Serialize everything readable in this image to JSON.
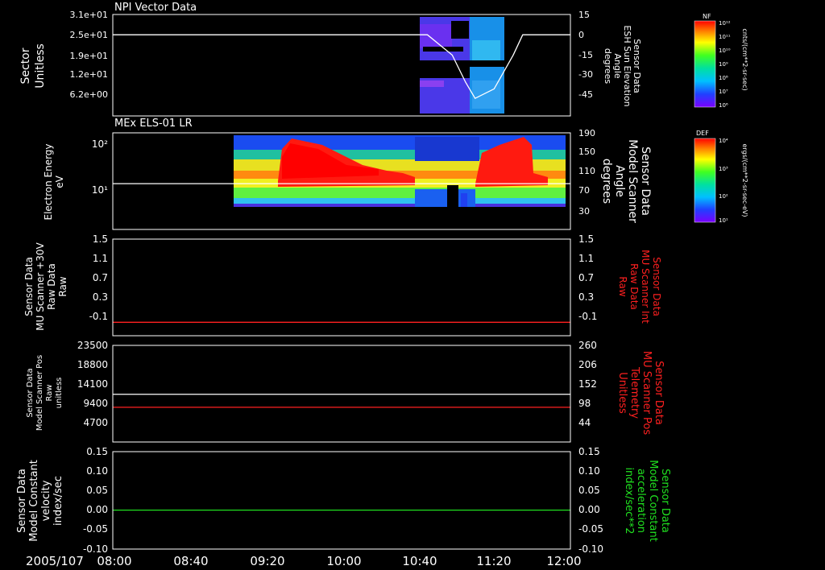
{
  "date_label": "2005/107",
  "time_ticks": [
    "08:00",
    "08:40",
    "09:20",
    "10:00",
    "10:40",
    "11:20",
    "12:00"
  ],
  "colors": {
    "white": "#ffffff",
    "red": "#ff2020",
    "green": "#20e020",
    "background": "#000000"
  },
  "panels": [
    {
      "id": "panel1",
      "title": "NPI Vector Data",
      "left_label": [
        "Sector",
        "Unitless"
      ],
      "left_ticks": [
        "3.1e+01",
        "2.5e+01",
        "1.9e+01",
        "1.2e+01",
        "6.2e+00"
      ],
      "right_label": [
        "Sensor Data",
        "ESH Sun Elevation",
        "Angle",
        "degrees"
      ],
      "right_ticks": [
        "15",
        "0",
        "-15",
        "-30",
        "-45"
      ]
    },
    {
      "id": "panel2",
      "title": "MEx ELS-01 LR",
      "left_label": [
        "Electron Energy",
        "eV"
      ],
      "left_ticks": [
        "10²",
        "10¹"
      ],
      "right_label": [
        "Sensor Data",
        "Model Scanner",
        "Angle",
        "degrees"
      ],
      "right_ticks": [
        "190",
        "150",
        "110",
        "70",
        "30"
      ]
    },
    {
      "id": "panel3",
      "left_label": [
        "Sensor Data",
        "MU Scanner +30V",
        "Raw Data",
        "Raw"
      ],
      "left_ticks": [
        "1.5",
        "1.1",
        "0.7",
        "0.3",
        "-0.1"
      ],
      "right_label": [
        "Sensor Data",
        "MU Scanner Int",
        "Raw Data",
        "Raw"
      ],
      "right_ticks": [
        "1.5",
        "1.1",
        "0.7",
        "0.3",
        "-0.1"
      ]
    },
    {
      "id": "panel4",
      "left_label": [
        "Sensor Data",
        "Model Scanner Pos",
        "Raw",
        "unitless"
      ],
      "left_ticks": [
        "23500",
        "18800",
        "14100",
        "9400",
        "4700"
      ],
      "right_label": [
        "Sensor Data",
        "MU Scanner Pos",
        "Telemetry",
        "Unitless"
      ],
      "right_ticks": [
        "260",
        "206",
        "152",
        "98",
        "44"
      ]
    },
    {
      "id": "panel5",
      "left_label": [
        "Sensor Data",
        "Model Constant",
        "velocity",
        "index/sec"
      ],
      "left_ticks": [
        "0.15",
        "0.10",
        "0.05",
        "0.00",
        "-0.05",
        "-0.10"
      ],
      "right_label": [
        "Sensor Data",
        "Model Constant",
        "acceleration",
        "index/sec**2"
      ],
      "right_ticks": [
        "0.15",
        "0.10",
        "0.05",
        "0.00",
        "-0.05",
        "-0.10"
      ]
    }
  ],
  "colorbars": [
    {
      "id": "colorbar-nf",
      "title": "NF",
      "units": "cnts/(cm**2-sr-sec)",
      "ticks": [
        "10¹²",
        "10¹¹",
        "10¹⁰",
        "10⁹",
        "10⁸",
        "10⁷",
        "10⁶"
      ]
    },
    {
      "id": "colorbar-def",
      "title": "DEF",
      "units": "ergs/(cm**2-sr-sec-eV)",
      "ticks": [
        "10⁴",
        "10³",
        "10²",
        "10¹"
      ]
    }
  ],
  "chart_data": [
    {
      "type": "heatmap",
      "title": "NPI Vector Data",
      "ylabel": "Sector Unitless",
      "x_range": [
        "08:00",
        "12:00"
      ],
      "y_range": [
        0,
        31
      ],
      "data_extent": [
        "10:40",
        "11:25"
      ],
      "overlay_line": {
        "name": "ESH Sun Elevation Angle",
        "axis": "right",
        "ylim": [
          -60,
          15
        ],
        "x": [
          "08:00",
          "10:45",
          "10:58",
          "11:05",
          "11:10",
          "11:20",
          "11:30",
          "11:35",
          "12:00"
        ],
        "y": [
          0,
          0,
          -15,
          -35,
          -47,
          -40,
          -15,
          0,
          0
        ]
      }
    },
    {
      "type": "heatmap",
      "title": "MEx ELS-01 LR",
      "ylabel": "Electron Energy eV",
      "yscale": "log",
      "x_range": [
        "08:00",
        "12:00"
      ],
      "data_extent": [
        "09:00",
        "12:00"
      ],
      "overlay_line": {
        "name": "Model Scanner Angle",
        "axis": "right",
        "ylim": [
          0,
          190
        ],
        "x": [
          "08:00",
          "12:00"
        ],
        "y": [
          90,
          90
        ]
      }
    },
    {
      "type": "line",
      "x_range": [
        "08:00",
        "12:00"
      ],
      "ylim": [
        -0.3,
        1.5
      ],
      "series": [
        {
          "name": "MU Scanner Int Raw Data",
          "color": "#ff2020",
          "x": [
            "08:00",
            "12:00"
          ],
          "y": [
            -0.05,
            -0.05
          ]
        }
      ]
    },
    {
      "type": "line",
      "x_range": [
        "08:00",
        "12:00"
      ],
      "ylim": [
        0,
        23500
      ],
      "y2lim": [
        -10,
        260
      ],
      "series": [
        {
          "name": "Model Scanner Pos Raw",
          "color": "#ffffff",
          "x": [
            "08:00",
            "12:00"
          ],
          "y": [
            11600,
            11600
          ]
        },
        {
          "name": "MU Scanner Pos Telemetry",
          "color": "#ff2020",
          "axis": "right",
          "x": [
            "08:00",
            "12:00"
          ],
          "y": [
            87,
            87
          ]
        }
      ]
    },
    {
      "type": "line",
      "x_range": [
        "08:00",
        "12:00"
      ],
      "ylim": [
        -0.1,
        0.15
      ],
      "series": [
        {
          "name": "Model Constant velocity",
          "color": "#20e020",
          "x": [
            "08:00",
            "12:00"
          ],
          "y": [
            0.0,
            0.0
          ]
        }
      ]
    }
  ]
}
